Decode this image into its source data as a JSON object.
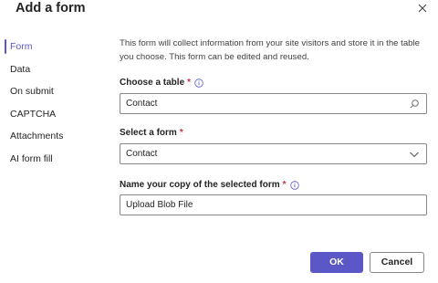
{
  "dialog": {
    "title": "Add a form"
  },
  "nav": {
    "items": [
      {
        "label": "Form",
        "active": true
      },
      {
        "label": "Data",
        "active": false
      },
      {
        "label": "On submit",
        "active": false
      },
      {
        "label": "CAPTCHA",
        "active": false
      },
      {
        "label": "Attachments",
        "active": false
      },
      {
        "label": "AI form fill",
        "active": false
      }
    ]
  },
  "main": {
    "description": "This form will collect information from your site visitors and store it in the table you choose. This form can be edited and reused.",
    "choose_table": {
      "label": "Choose a table",
      "required": "*",
      "value": "Contact"
    },
    "select_form": {
      "label": "Select a form",
      "required": "*",
      "value": "Contact"
    },
    "form_name": {
      "label": "Name your copy of the selected form",
      "required": "*",
      "value": "Upload Blob File"
    }
  },
  "footer": {
    "ok_label": "OK",
    "cancel_label": "Cancel"
  },
  "colors": {
    "accent": "#5b57c7",
    "required": "#c4314b",
    "border": "#8a8886"
  }
}
